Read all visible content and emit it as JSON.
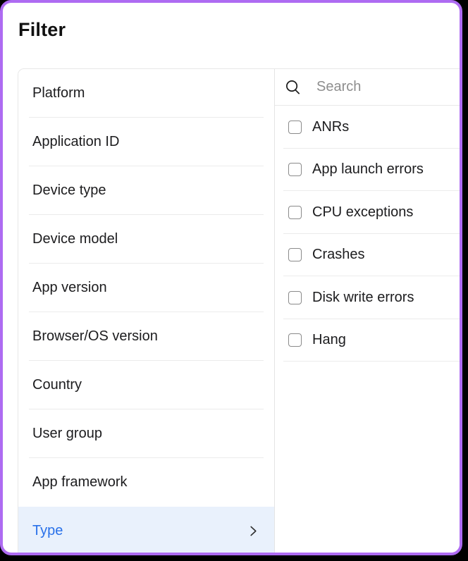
{
  "header": {
    "title": "Filter"
  },
  "categories": [
    {
      "label": "Platform",
      "selected": false
    },
    {
      "label": "Application ID",
      "selected": false
    },
    {
      "label": "Device type",
      "selected": false
    },
    {
      "label": "Device model",
      "selected": false
    },
    {
      "label": "App version",
      "selected": false
    },
    {
      "label": "Browser/OS version",
      "selected": false
    },
    {
      "label": "Country",
      "selected": false
    },
    {
      "label": "User group",
      "selected": false
    },
    {
      "label": "App framework",
      "selected": false
    },
    {
      "label": "Type",
      "selected": true
    }
  ],
  "type_options": {
    "search": {
      "placeholder": "Search",
      "value": ""
    },
    "items": [
      {
        "label": "ANRs",
        "checked": false
      },
      {
        "label": "App launch errors",
        "checked": false
      },
      {
        "label": "CPU exceptions",
        "checked": false
      },
      {
        "label": "Crashes",
        "checked": false
      },
      {
        "label": "Disk write errors",
        "checked": false
      },
      {
        "label": "Hang",
        "checked": false
      }
    ]
  },
  "icons": {
    "search": "magnifier-icon",
    "selected_category": "chevron-right-icon"
  },
  "colors": {
    "card_border": "#AE6BF2",
    "selected_row_bg": "#E9F1FC",
    "selected_row_text": "#2971E9",
    "divider": "#EBEBEB",
    "text": "#1C1C1E",
    "placeholder": "#8E8E8E",
    "background": "#FFFFFF"
  }
}
